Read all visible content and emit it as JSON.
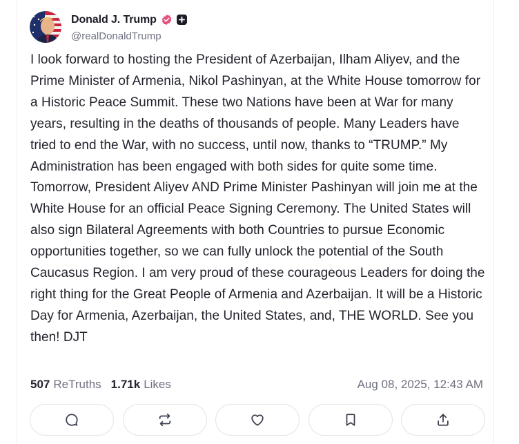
{
  "post": {
    "author": {
      "display_name": "Donald J. Trump",
      "handle": "@realDonaldTrump",
      "verified_icon": "verified-badge-icon",
      "extra_icon": "plus-square-icon"
    },
    "text": "I look forward to hosting the President of Azerbaijan, Ilham Aliyev, and the Prime Minister of Armenia, Nikol Pashinyan, at the White House tomorrow for a Historic Peace Summit. These two Nations have been at War for many years, resulting in the deaths of thousands of people. Many Leaders have tried to end the War, with no success, until now, thanks to “TRUMP.” My Administration has been engaged with both sides for quite some time. Tomorrow, President Aliyev AND Prime Minister Pashinyan will join me at the White House for an official Peace Signing Ceremony. The United States will also sign Bilateral Agreements with both Countries to pursue Economic opportunities together, so we can fully unlock the potential of the South Caucasus Region. I am very proud of these courageous Leaders for doing the right thing for the Great People of Armenia and Azerbaijan. It will be a Historic Day for Armenia, Azerbaijan, the United States, and, THE WORLD. See you then! DJT",
    "stats": {
      "retruths_count": "507",
      "retruths_label": "ReTruths",
      "likes_count": "1.71k",
      "likes_label": "Likes"
    },
    "timestamp": "Aug 08, 2025, 12:43 AM"
  },
  "actions": [
    {
      "name": "reply",
      "icon": "comment-icon"
    },
    {
      "name": "retruth",
      "icon": "repost-icon"
    },
    {
      "name": "like",
      "icon": "heart-icon"
    },
    {
      "name": "bookmark",
      "icon": "bookmark-icon"
    },
    {
      "name": "share",
      "icon": "share-icon"
    }
  ],
  "colors": {
    "text": "#23232d",
    "muted": "#6f7182",
    "verified": "#e5507a",
    "button_border": "#e4e4ec"
  }
}
